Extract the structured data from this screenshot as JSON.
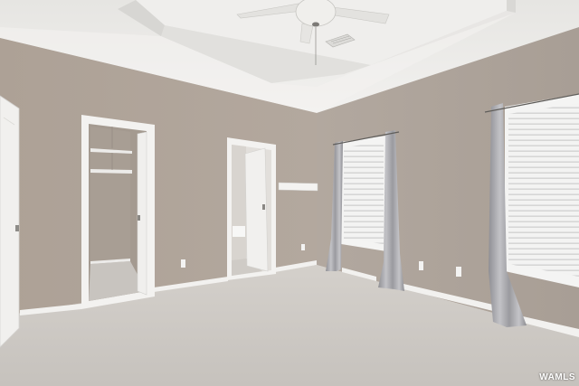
{
  "photo": {
    "watermark": "WAMLS"
  },
  "colors": {
    "wall": "#b0a59b",
    "ceiling": "#ecebe8",
    "carpet": "#cdc9c4",
    "trim": "#f4f3f1",
    "curtain": "#a9a9ad",
    "blinds": "#f1f1f0"
  }
}
